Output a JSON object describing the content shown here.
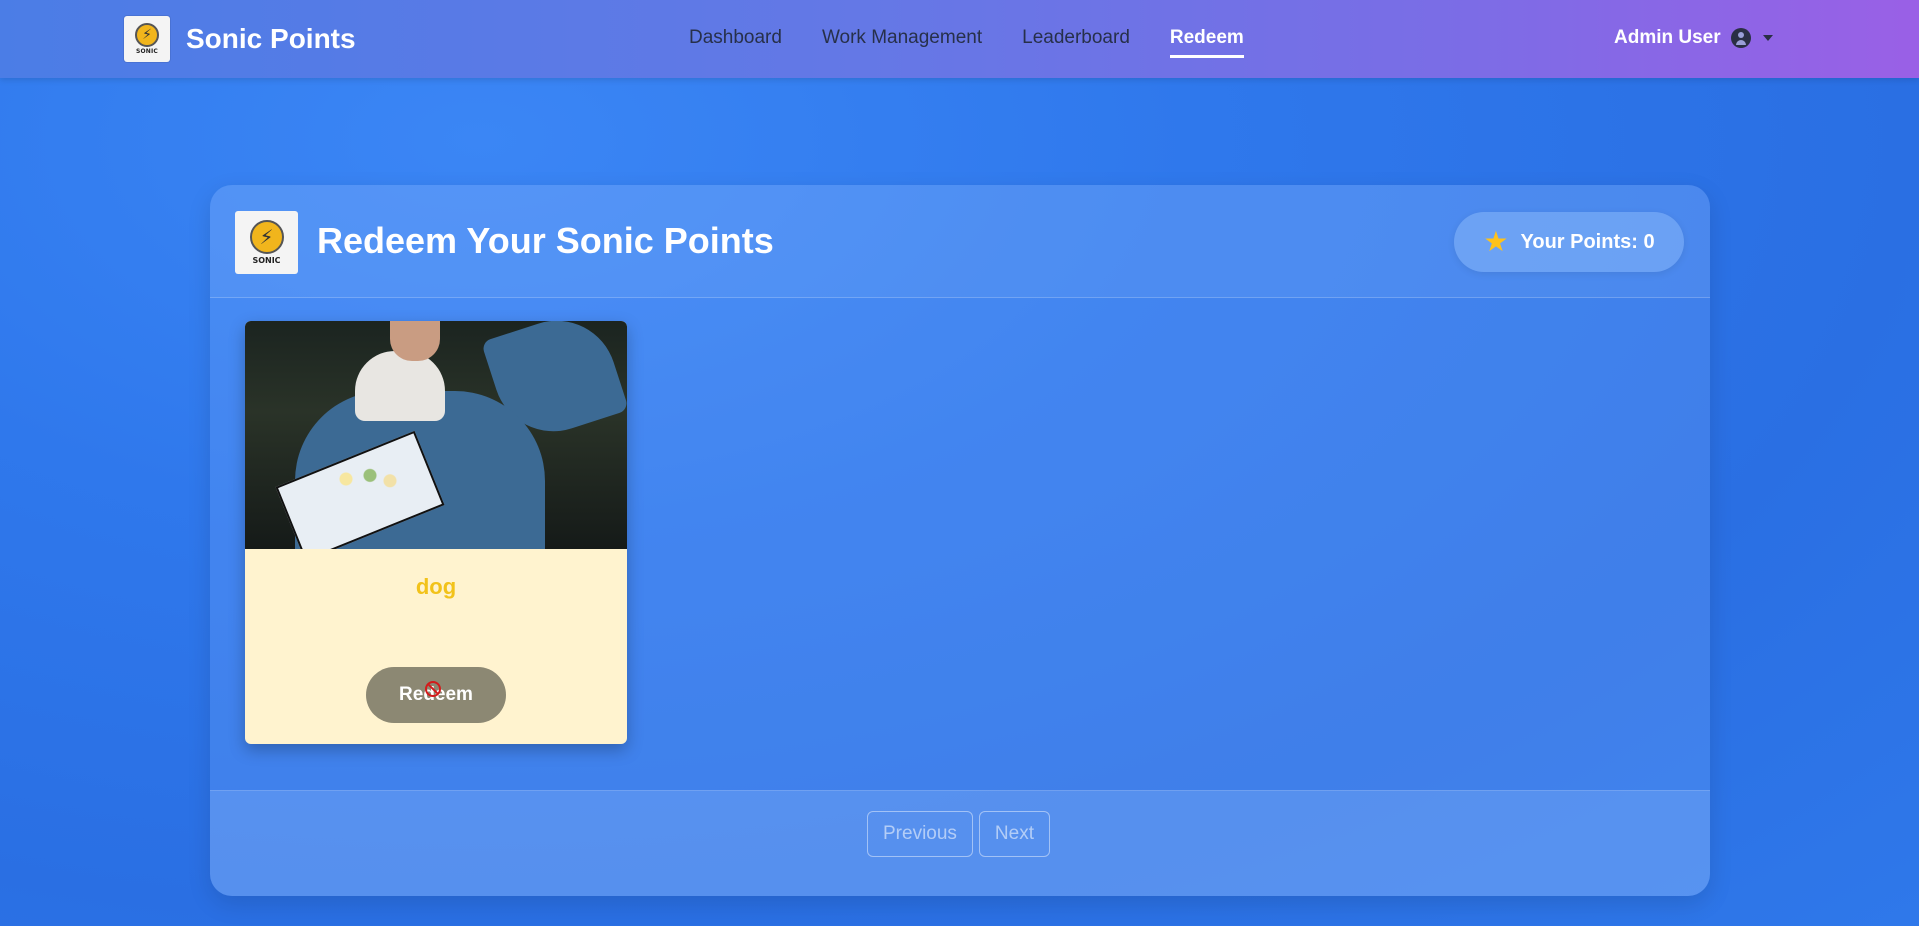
{
  "navbar": {
    "brand": {
      "logo_text": "SONIC",
      "name": "Sonic Points"
    },
    "links": [
      {
        "label": "Dashboard",
        "active": false
      },
      {
        "label": "Work Management",
        "active": false
      },
      {
        "label": "Leaderboard",
        "active": false
      },
      {
        "label": "Redeem",
        "active": true
      }
    ],
    "user": {
      "name": "Admin User",
      "icon": "user-circle-icon"
    }
  },
  "page": {
    "logo_text": "SONIC",
    "title": "Redeem Your Sonic Points",
    "points": {
      "icon": "star-icon",
      "label": "Your Points: 0"
    }
  },
  "rewards": [
    {
      "title": "dog",
      "description": "",
      "button_label": "Redeem",
      "button_disabled": true
    }
  ],
  "pagination": {
    "previous_label": "Previous",
    "next_label": "Next"
  },
  "colors": {
    "nav_gradient_start": "#4b7de6",
    "nav_gradient_end": "#9a60e6",
    "background": "#2f78ec",
    "card_background": "#fff3cf",
    "card_title": "#f2c21a",
    "star": "#ffc21a",
    "disabled_button": "#8c8873"
  }
}
